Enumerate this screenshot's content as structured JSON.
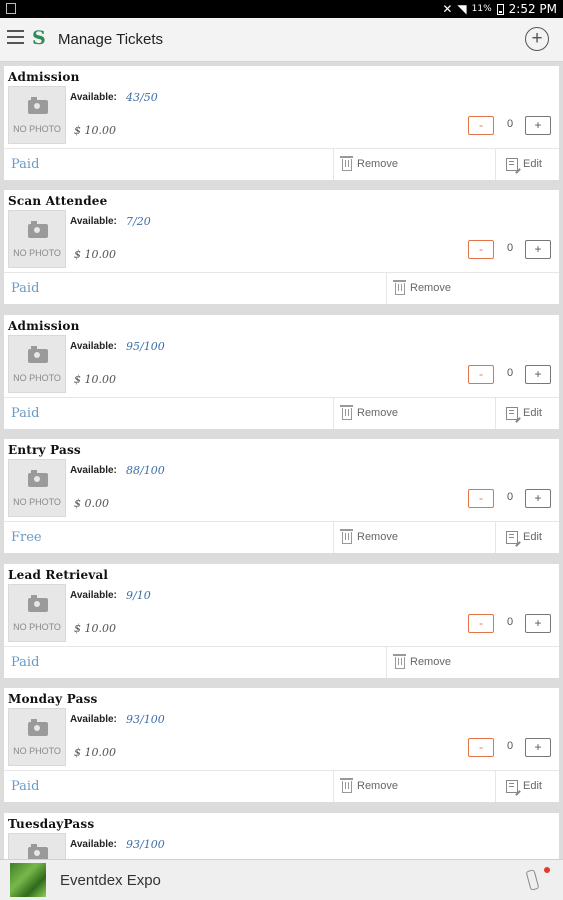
{
  "status_bar": {
    "battery": "11%",
    "time": "2:52 PM"
  },
  "app_bar": {
    "title": "Manage Tickets"
  },
  "tickets": [
    {
      "name": "Admission",
      "available_label": "Available:",
      "available": "43/50",
      "price": "$ 10.00",
      "qty": "0",
      "minus": "-",
      "plus": "+",
      "type": "Paid",
      "remove": "Remove",
      "edit": "Edit",
      "no_photo": "NO PHOTO"
    },
    {
      "name": "Scan Attendee",
      "available_label": "Available:",
      "available": "7/20",
      "price": "$ 10.00",
      "qty": "0",
      "minus": "-",
      "plus": "+",
      "type": "Paid",
      "remove": "Remove",
      "no_photo": "NO PHOTO"
    },
    {
      "name": "Admission",
      "available_label": "Available:",
      "available": "95/100",
      "price": "$ 10.00",
      "qty": "0",
      "minus": "-",
      "plus": "+",
      "type": "Paid",
      "remove": "Remove",
      "edit": "Edit",
      "no_photo": "NO PHOTO"
    },
    {
      "name": "Entry Pass",
      "available_label": "Available:",
      "available": "88/100",
      "price": "$ 0.00",
      "qty": "0",
      "minus": "-",
      "plus": "+",
      "type": "Free",
      "remove": "Remove",
      "edit": "Edit",
      "no_photo": "NO PHOTO"
    },
    {
      "name": "Lead Retrieval",
      "available_label": "Available:",
      "available": "9/10",
      "price": "$ 10.00",
      "qty": "0",
      "minus": "-",
      "plus": "+",
      "type": "Paid",
      "remove": "Remove",
      "no_photo": "NO PHOTO"
    },
    {
      "name": "Monday Pass",
      "available_label": "Available:",
      "available": "93/100",
      "price": "$ 10.00",
      "qty": "0",
      "minus": "-",
      "plus": "+",
      "type": "Paid",
      "remove": "Remove",
      "edit": "Edit",
      "no_photo": "NO PHOTO"
    },
    {
      "name": "TuesdayPass",
      "available_label": "Available:",
      "available": "93/100"
    }
  ],
  "footer": {
    "event_name": "Eventdex Expo"
  },
  "colors": {
    "accent_orange": "#e2744a",
    "link_blue": "#3a6fa8",
    "brand_green": "#2e8b57"
  }
}
